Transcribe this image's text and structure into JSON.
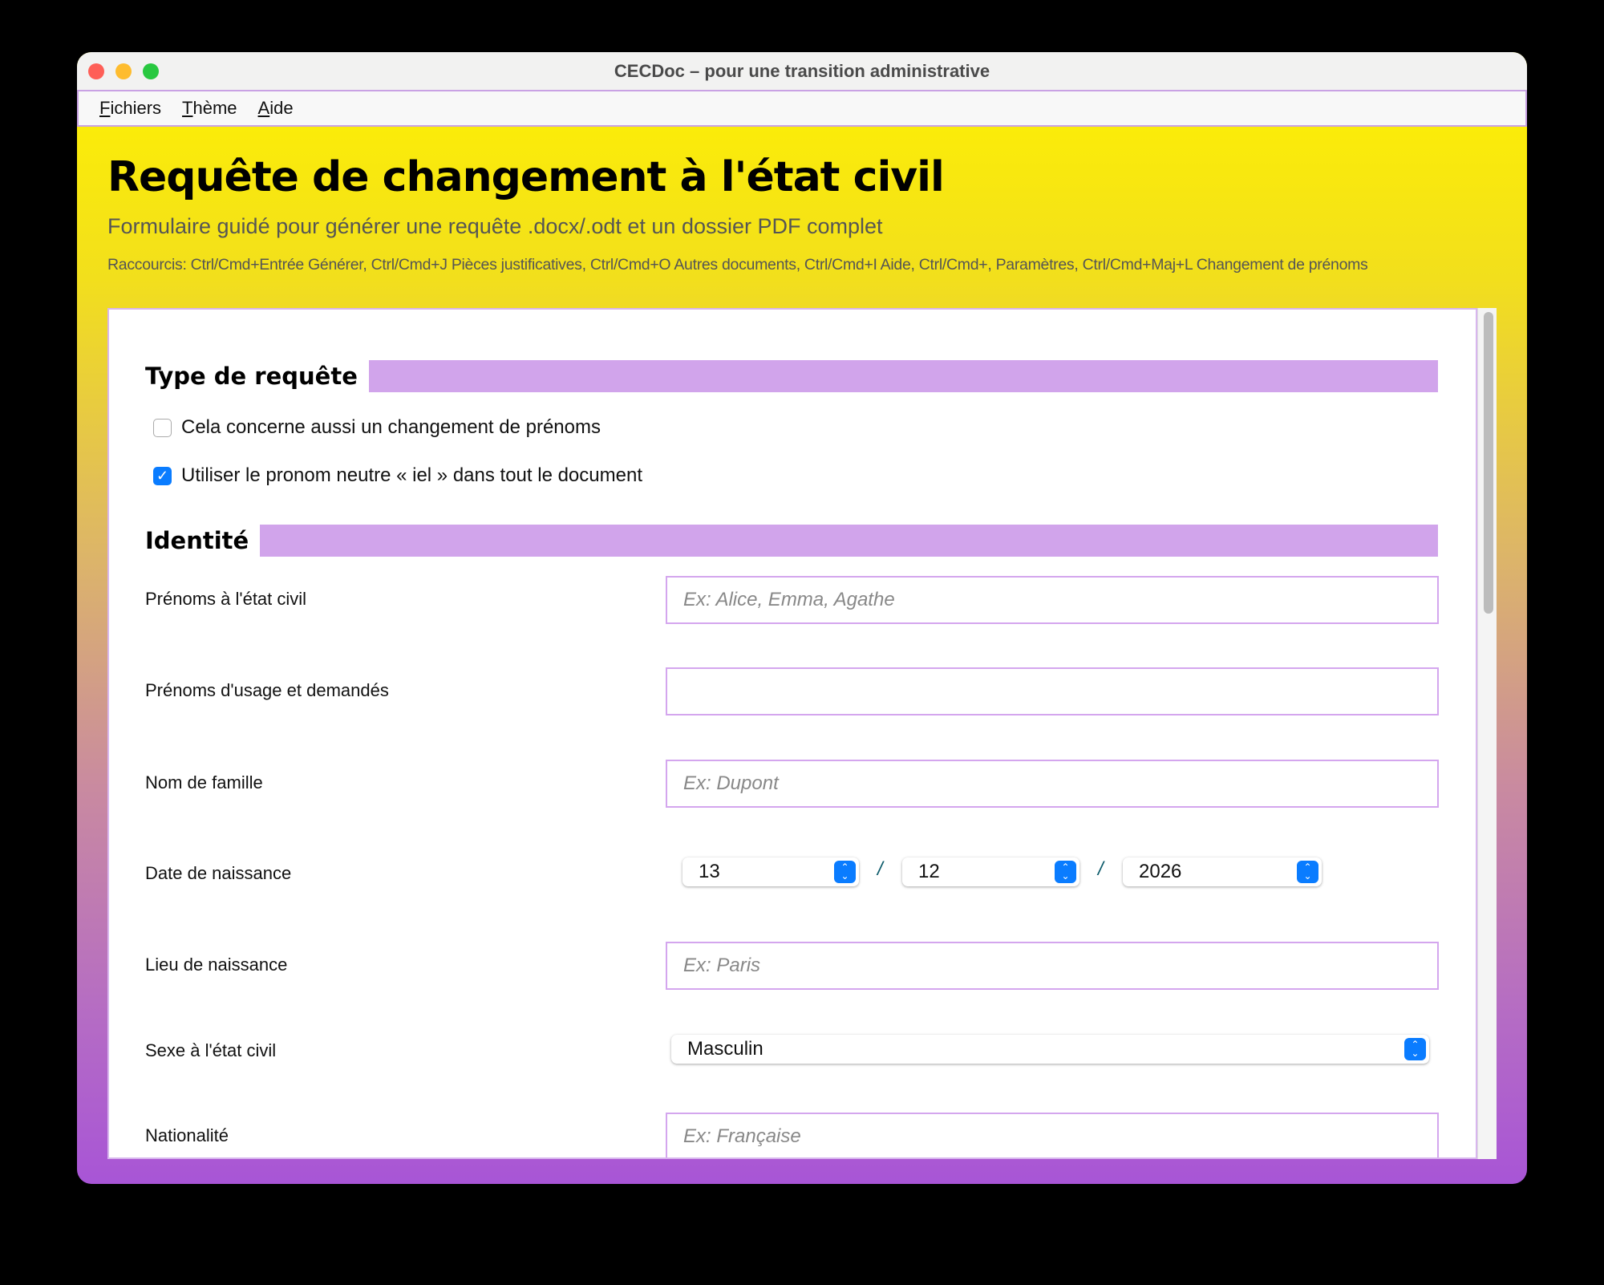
{
  "window": {
    "title": "CECDoc – pour une transition administrative"
  },
  "menu": [
    {
      "label": "Fichiers",
      "mn": "F",
      "rest": "ichiers"
    },
    {
      "label": "Thème",
      "mn": "T",
      "rest": "hème"
    },
    {
      "label": "Aide",
      "mn": "A",
      "rest": "ide"
    }
  ],
  "header": {
    "title": "Requête de changement à l'état civil",
    "subtitle": "Formulaire guidé pour générer une requête .docx/.odt et un dossier PDF complet",
    "shortcuts": "Raccourcis: Ctrl/Cmd+Entrée Générer, Ctrl/Cmd+J Pièces justificatives, Ctrl/Cmd+O Autres documents, Ctrl/Cmd+I Aide, Ctrl/Cmd+, Paramètres, Ctrl/Cmd+Maj+L Changement de prénoms"
  },
  "type_section": {
    "title": "Type de requête",
    "options": [
      {
        "label": "Cela concerne aussi un changement de prénoms",
        "checked": false
      },
      {
        "label": "Utiliser le pronom neutre « iel » dans tout le document",
        "checked": true
      }
    ]
  },
  "identity": {
    "title": "Identité",
    "prenoms_civil": {
      "label": "Prénoms à l'état civil",
      "placeholder": "Ex: Alice, Emma, Agathe",
      "value": ""
    },
    "prenoms_usage": {
      "label": "Prénoms d'usage et demandés",
      "placeholder": "",
      "value": ""
    },
    "nom": {
      "label": "Nom de famille",
      "placeholder": "Ex: Dupont",
      "value": ""
    },
    "date": {
      "label": "Date de naissance",
      "day": "13",
      "month": "12",
      "year": "2026",
      "separator": "/"
    },
    "lieu": {
      "label": "Lieu de naissance",
      "placeholder": "Ex: Paris",
      "value": ""
    },
    "sexe": {
      "label": "Sexe à l'état civil",
      "value": "Masculin"
    },
    "nationalite": {
      "label": "Nationalité",
      "placeholder": "Ex: Française",
      "value": ""
    }
  },
  "colors": {
    "accent": "#0a7cff",
    "section_bar": "#d1a4eb",
    "gradient_top": "#fff200",
    "gradient_bottom": "#a855d6"
  }
}
